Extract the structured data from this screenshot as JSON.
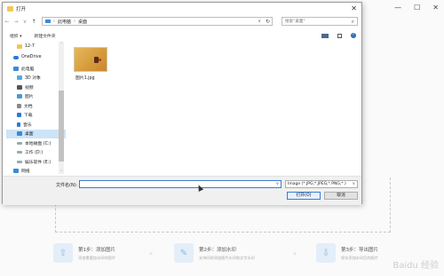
{
  "dialog": {
    "title": "打开",
    "close_glyph": "✕",
    "nav": {
      "back": "←",
      "forward": "→",
      "dropdown": "∨",
      "up": "↑"
    },
    "address": {
      "parts": [
        "此电脑",
        "桌面"
      ],
      "sep": "›",
      "refresh": "↻",
      "drop": "∨"
    },
    "search": {
      "placeholder": "搜索\"桌面\"",
      "icon": "⌕"
    },
    "toolbar": {
      "organize": "组织 ▾",
      "new_folder": "新建文件夹",
      "help": "?"
    },
    "nav_items": [
      {
        "label": "12-7",
        "icon": "folder-icon"
      },
      {
        "label": "OneDrive",
        "icon": "cloud-icon"
      },
      {
        "label": "此电脑",
        "icon": "pc-icon"
      },
      {
        "label": "3D 对象",
        "icon": "cube-icon"
      },
      {
        "label": "视频",
        "icon": "video-icon"
      },
      {
        "label": "图片",
        "icon": "picture-icon"
      },
      {
        "label": "文档",
        "icon": "document-icon"
      },
      {
        "label": "下载",
        "icon": "download-icon"
      },
      {
        "label": "音乐",
        "icon": "music-icon"
      },
      {
        "label": "桌面",
        "icon": "desktop-icon",
        "selected": true
      },
      {
        "label": "本地磁盘 (C:)",
        "icon": "drive-icon"
      },
      {
        "label": "工作 (D:)",
        "icon": "drive-icon"
      },
      {
        "label": "娱乐软件 (E:)",
        "icon": "drive-icon"
      },
      {
        "label": "网络",
        "icon": "network-icon"
      }
    ],
    "scroll": {
      "up": "˄",
      "down": "˅"
    },
    "file": {
      "name": "图片1.jpg"
    },
    "bottom": {
      "filename_label": "文件名(N):",
      "filename_value": "",
      "dropdown_glyph": "∨",
      "filetype": "Image (*.JPG;*.JPEG;*.PNG;*.)",
      "open_button": "打开(O)",
      "cancel_button": "取消"
    }
  },
  "background": {
    "window_buttons": [
      "—",
      "☐",
      "✕"
    ],
    "steps": [
      {
        "title": "第1步：添加图片",
        "desc": "添加需要加水印的图片",
        "icon": "⇧"
      },
      {
        "title": "第2步：添加水印",
        "desc": "支持同时添加图片水印和文字水印",
        "icon": "✎"
      },
      {
        "title": "第3步：导出图片",
        "desc": "保存添加水印后的图片",
        "icon": "⇩"
      }
    ],
    "arrow": "»",
    "watermark": "Baidu 经验"
  }
}
